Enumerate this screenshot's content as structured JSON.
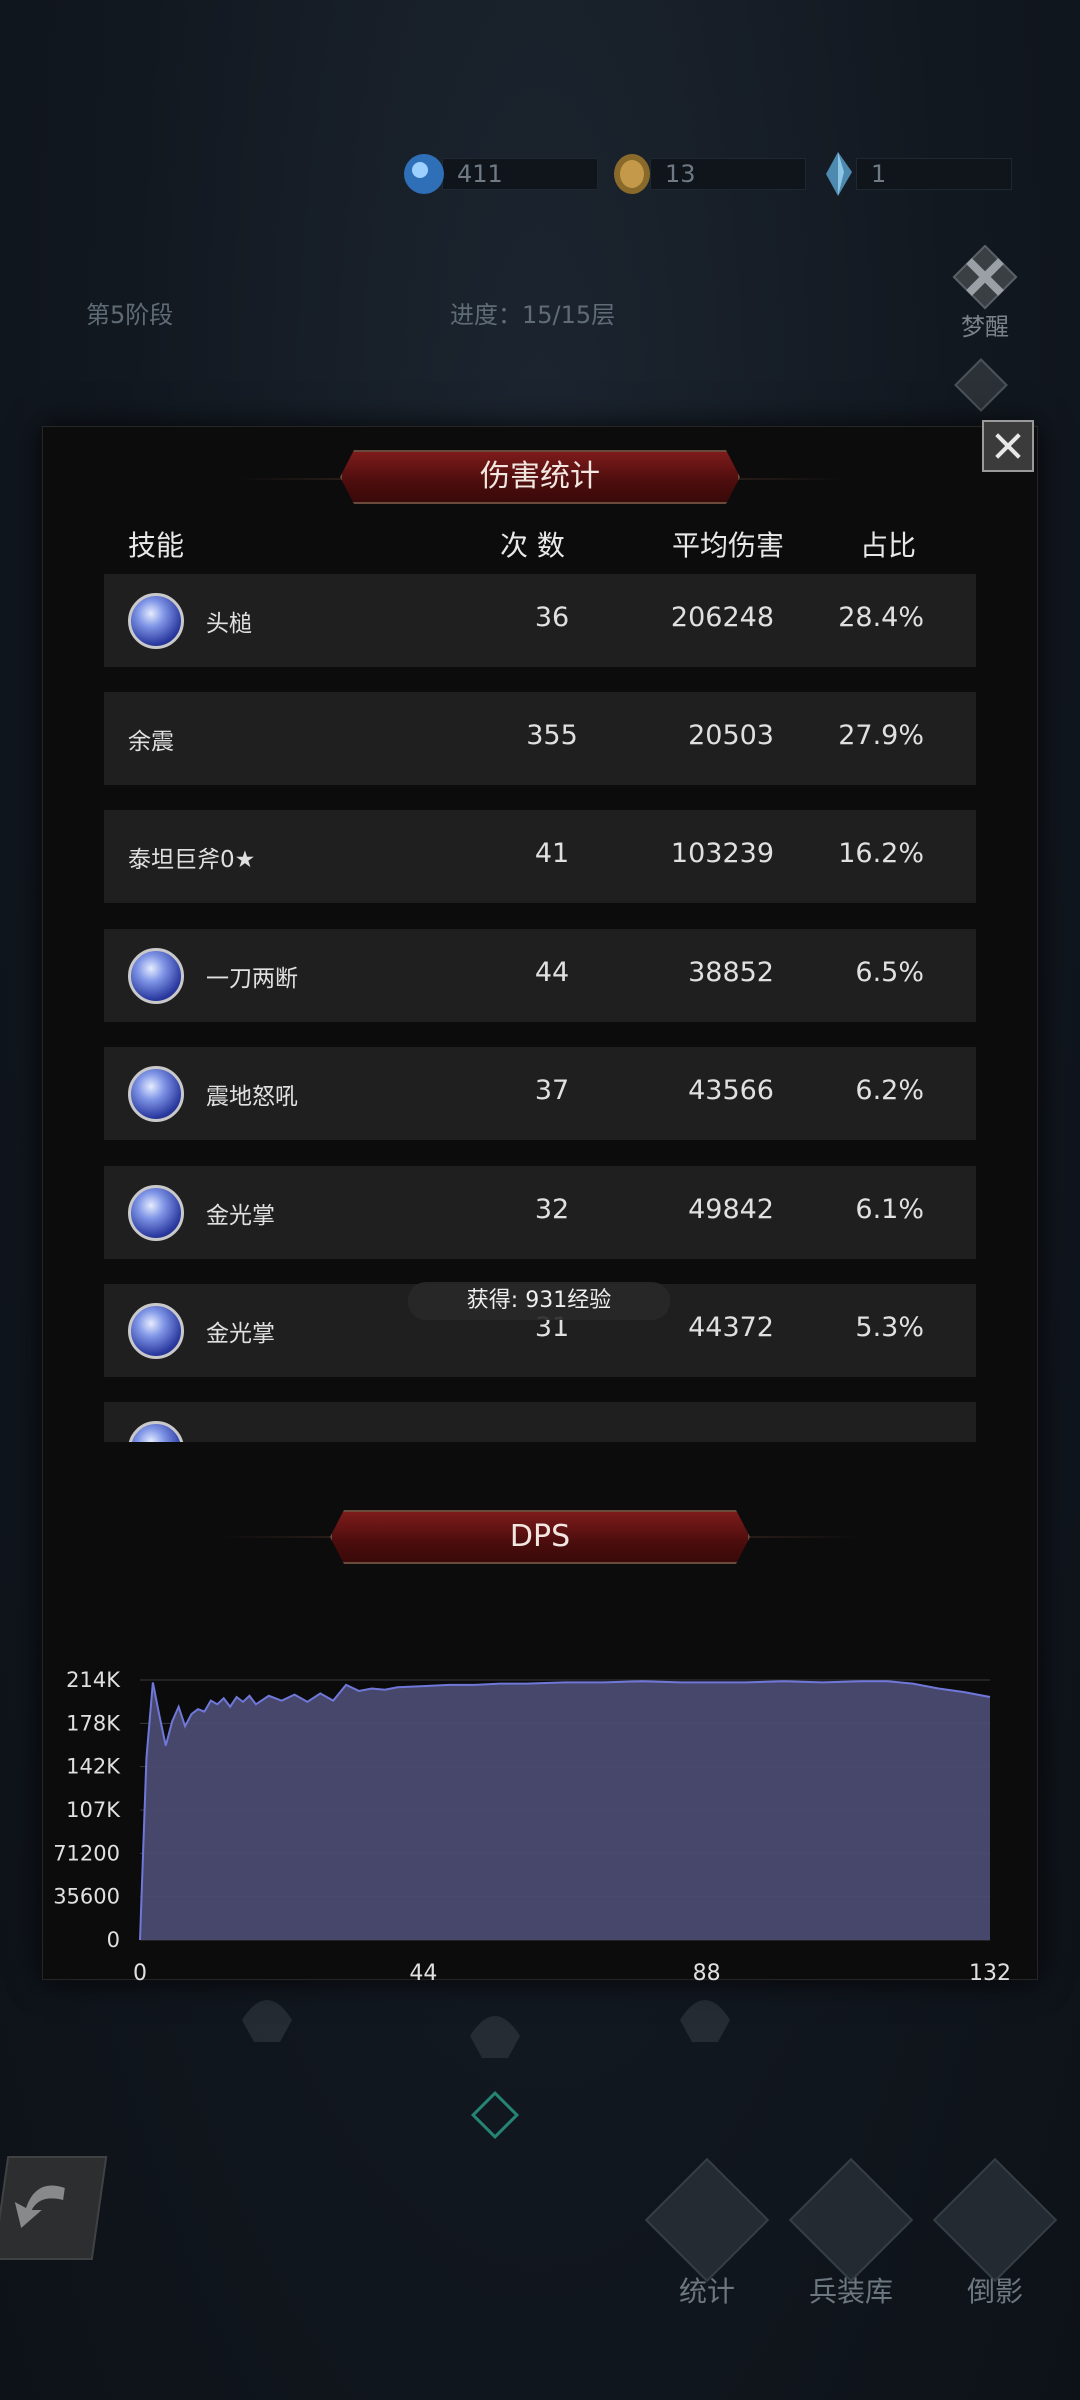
{
  "resources": [
    {
      "name": "blue-orb",
      "value": "411",
      "color": "#3c7fd0"
    },
    {
      "name": "gold-coin",
      "value": "13",
      "color": "#b58a3c"
    },
    {
      "name": "crystal",
      "value": "1",
      "color": "#6aa3c4"
    }
  ],
  "stage": {
    "label": "第5阶段",
    "progress": "进度：15/15层"
  },
  "top_right": {
    "awaken_label": "梦醒"
  },
  "modal": {
    "damage_title": "伤害统计",
    "columns": {
      "skill": "技能",
      "count": "次 数",
      "avg": "平均伤害",
      "ratio": "占比"
    },
    "rows": [
      {
        "name": "头槌",
        "count": "36",
        "avg": "206248",
        "pct": "28.4%",
        "icon": true
      },
      {
        "name": "余震",
        "count": "355",
        "avg": "20503",
        "pct": "27.9%",
        "icon": false
      },
      {
        "name": "泰坦巨斧0★",
        "count": "41",
        "avg": "103239",
        "pct": "16.2%",
        "icon": false
      },
      {
        "name": "一刀两断",
        "count": "44",
        "avg": "38852",
        "pct": "6.5%",
        "icon": true
      },
      {
        "name": "震地怒吼",
        "count": "37",
        "avg": "43566",
        "pct": "6.2%",
        "icon": true
      },
      {
        "name": "金光掌",
        "count": "32",
        "avg": "49842",
        "pct": "6.1%",
        "icon": true
      },
      {
        "name": "金光掌",
        "count": "31",
        "avg": "44372",
        "pct": "5.3%",
        "icon": true
      }
    ],
    "toast": "获得: 931经验",
    "dps_title": "DPS"
  },
  "bottom_nav": [
    {
      "label": "统计"
    },
    {
      "label": "兵装库"
    },
    {
      "label": "倒影"
    }
  ],
  "chart_data": {
    "type": "area",
    "title": "DPS",
    "xlabel": "",
    "ylabel": "",
    "x_ticks": [
      "0",
      "44",
      "88",
      "132"
    ],
    "y_ticks": [
      "0",
      "35600",
      "71200",
      "107K",
      "142K",
      "178K",
      "214K"
    ],
    "xlim": [
      0,
      132
    ],
    "ylim": [
      0,
      214000
    ],
    "fill_color": "#4b4b72",
    "line_color": "#6f78d8",
    "x": [
      0,
      1,
      2,
      3,
      4,
      5,
      6,
      7,
      8,
      9,
      10,
      11,
      12,
      13,
      14,
      15,
      16,
      17,
      18,
      20,
      22,
      24,
      26,
      28,
      30,
      32,
      34,
      36,
      38,
      40,
      44,
      48,
      52,
      56,
      60,
      66,
      72,
      78,
      84,
      88,
      94,
      100,
      106,
      112,
      116,
      120,
      124,
      128,
      132
    ],
    "values": [
      0,
      150000,
      212000,
      185000,
      160000,
      180000,
      192000,
      176000,
      186000,
      190000,
      188000,
      197000,
      194000,
      199000,
      192000,
      200000,
      196000,
      201000,
      194000,
      201000,
      197000,
      202000,
      196000,
      203000,
      197000,
      210000,
      205000,
      207000,
      206000,
      208000,
      209000,
      210000,
      210000,
      211000,
      211000,
      212000,
      212000,
      213000,
      212000,
      212000,
      212000,
      213000,
      212000,
      213000,
      213000,
      211000,
      207000,
      204000,
      200000
    ]
  }
}
